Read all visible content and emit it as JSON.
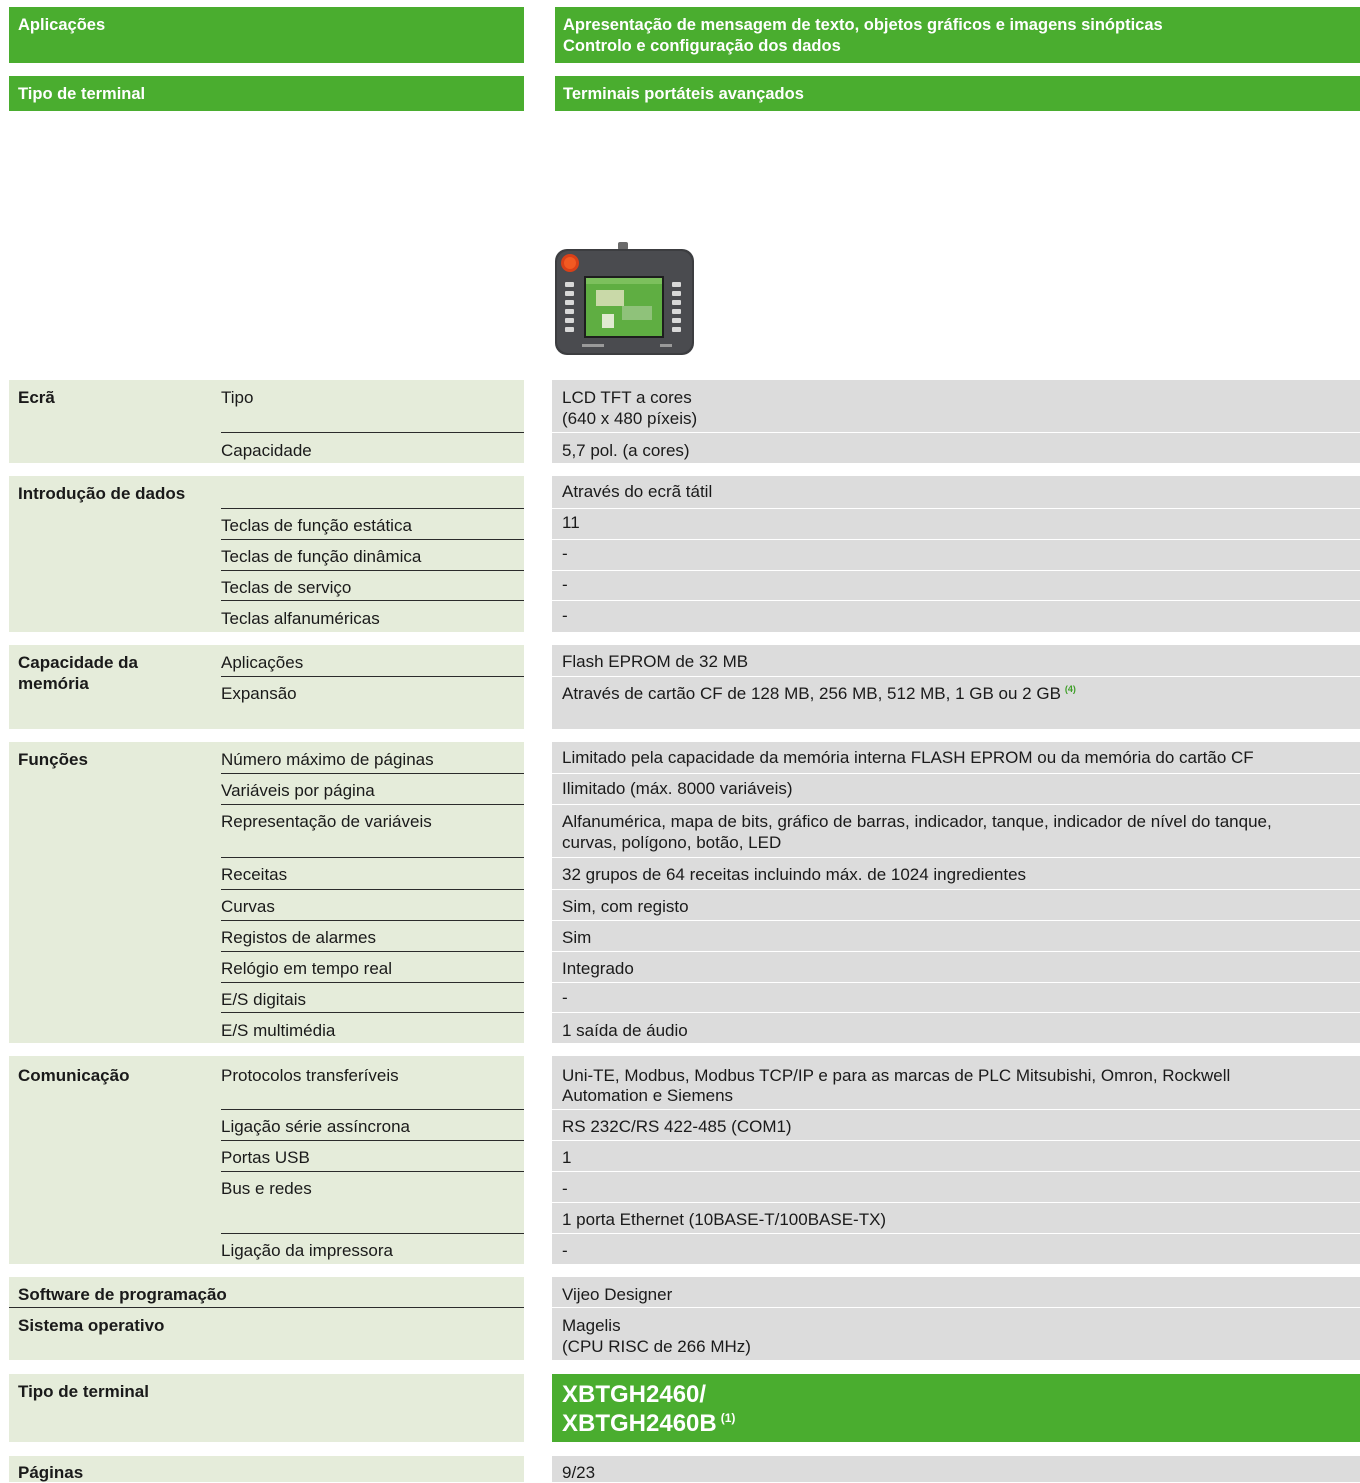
{
  "header": {
    "applications_label": "Aplicações",
    "applications_line1": "Apresentação de mensagem de texto, objetos gráficos e imagens sinópticas",
    "applications_line2": "Controlo e configuração dos dados",
    "terminal_type_label": "Tipo de terminal",
    "terminal_type_value": "Terminais portáteis avançados"
  },
  "product_image": {
    "icon": "handheld-terminal-photo"
  },
  "sections": {
    "screen": {
      "title": "Ecrã",
      "type_label": "Tipo",
      "type_value_line1": "LCD TFT a cores",
      "type_value_line2": "(640 x 480 píxeis)",
      "capacity_label": "Capacidade",
      "capacity_value": "5,7 pol. (a cores)"
    },
    "data_entry": {
      "title": "Introdução de dados",
      "main_value": "Através do ecrã tátil",
      "static_keys_label": "Teclas de função estática",
      "static_keys_value": "11",
      "dynamic_keys_label": "Teclas de função dinâmica",
      "dynamic_keys_value": "-",
      "service_keys_label": "Teclas de serviço",
      "service_keys_value": "-",
      "alpha_keys_label": "Teclas alfanuméricas",
      "alpha_keys_value": "-"
    },
    "memory": {
      "title_line1": "Capacidade da",
      "title_line2": "memória",
      "apps_label": "Aplicações",
      "apps_value": "Flash EPROM de 32 MB",
      "expansion_label": "Expansão",
      "expansion_value": "Através de cartão CF de 128 MB, 256 MB, 512 MB, 1 GB ou 2 GB",
      "expansion_note": "(4)"
    },
    "functions": {
      "title": "Funções",
      "max_pages_label": "Número máximo de páginas",
      "max_pages_value": "Limitado pela capacidade da memória interna FLASH EPROM ou da memória do cartão CF",
      "vars_per_page_label": "Variáveis por página",
      "vars_per_page_value": "Ilimitado (máx. 8000 variáveis)",
      "var_repr_label": "Representação de variáveis",
      "var_repr_value_line1": "Alfanumérica, mapa de bits, gráfico de barras, indicador, tanque, indicador de nível do tanque,",
      "var_repr_value_line2": "curvas, polígono, botão, LED",
      "recipes_label": "Receitas",
      "recipes_value": "32 grupos de 64 receitas incluindo máx. de 1024 ingredientes",
      "curves_label": "Curvas",
      "curves_value": "Sim, com registo",
      "alarm_logs_label": "Registos de alarmes",
      "alarm_logs_value": "Sim",
      "rtc_label": "Relógio em tempo real",
      "rtc_value": "Integrado",
      "digital_io_label": "E/S digitais",
      "digital_io_value": "-",
      "multimedia_io_label": "E/S multimédia",
      "multimedia_io_value": "1 saída de áudio"
    },
    "communication": {
      "title": "Comunicação",
      "protocols_label": "Protocolos transferíveis",
      "protocols_value_line1": "Uni-TE, Modbus, Modbus TCP/IP e para as marcas de PLC Mitsubishi, Omron, Rockwell",
      "protocols_value_line2": "Automation e Siemens",
      "serial_label": "Ligação série assíncrona",
      "serial_value": "RS 232C/RS 422-485 (COM1)",
      "usb_label": "Portas USB",
      "usb_value": "1",
      "bus_label": "Bus e redes",
      "bus_value": "-",
      "ethernet_value": "1 porta Ethernet (10BASE-T/100BASE-TX)",
      "printer_label": "Ligação da impressora",
      "printer_value": "-"
    },
    "software": {
      "title": "Software de programação",
      "value": "Vijeo Designer"
    },
    "os": {
      "title": "Sistema operativo",
      "value_line1": "Magelis",
      "value_line2": "(CPU RISC de 266 MHz)"
    },
    "terminal_ref": {
      "title": "Tipo de terminal",
      "ref_line1": "XBTGH2460/",
      "ref_line2": "XBTGH2460B",
      "ref_note": "(1)"
    },
    "pages": {
      "title": "Páginas",
      "value": "9/23"
    }
  },
  "colors": {
    "header_green": "#4aad2f",
    "left_bg": "#e5ecda",
    "right_bg": "#dcdcdc"
  }
}
